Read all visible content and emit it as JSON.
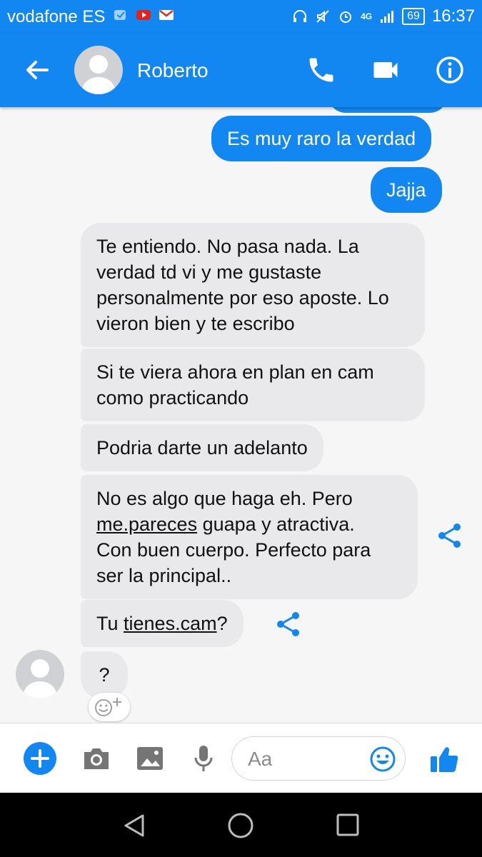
{
  "status_bar": {
    "carrier": "vodafone ES",
    "battery": "69",
    "time": "16:37",
    "network": "4G"
  },
  "header": {
    "contact_name": "Roberto"
  },
  "messages": [
    {
      "side": "out",
      "text": "Es muy raro la verdad"
    },
    {
      "side": "out",
      "text": "Jajja"
    },
    {
      "side": "in",
      "text": "Te entiendo. No pasa nada. La verdad td vi y me gustaste personalmente por eso aposte. Lo vieron bien y te escribo"
    },
    {
      "side": "in",
      "text": "Si te viera ahora en plan en cam como practicando"
    },
    {
      "side": "in",
      "text": "Podria darte un adelanto"
    },
    {
      "side": "in",
      "line1": "No es algo que haga eh. Pero",
      "link": "me.pareces",
      "line2": " guapa y atractiva.",
      "line3": "Con buen cuerpo. Perfecto para",
      "line4": "ser la principal.."
    },
    {
      "side": "in",
      "pre": "Tu ",
      "link": "tienes.cam",
      "post": "?"
    },
    {
      "side": "in",
      "text": "?"
    }
  ],
  "composer": {
    "placeholder": "Aa"
  },
  "colors": {
    "accent": "#1286f1",
    "incoming_bubble": "#e9e9eb",
    "background": "#f6f6f6"
  },
  "icons": [
    "back-arrow-icon",
    "phone-icon",
    "video-camera-icon",
    "info-icon",
    "share-icon",
    "add-icon",
    "camera-icon",
    "image-icon",
    "microphone-icon",
    "emoji-icon",
    "thumbs-up-icon"
  ]
}
